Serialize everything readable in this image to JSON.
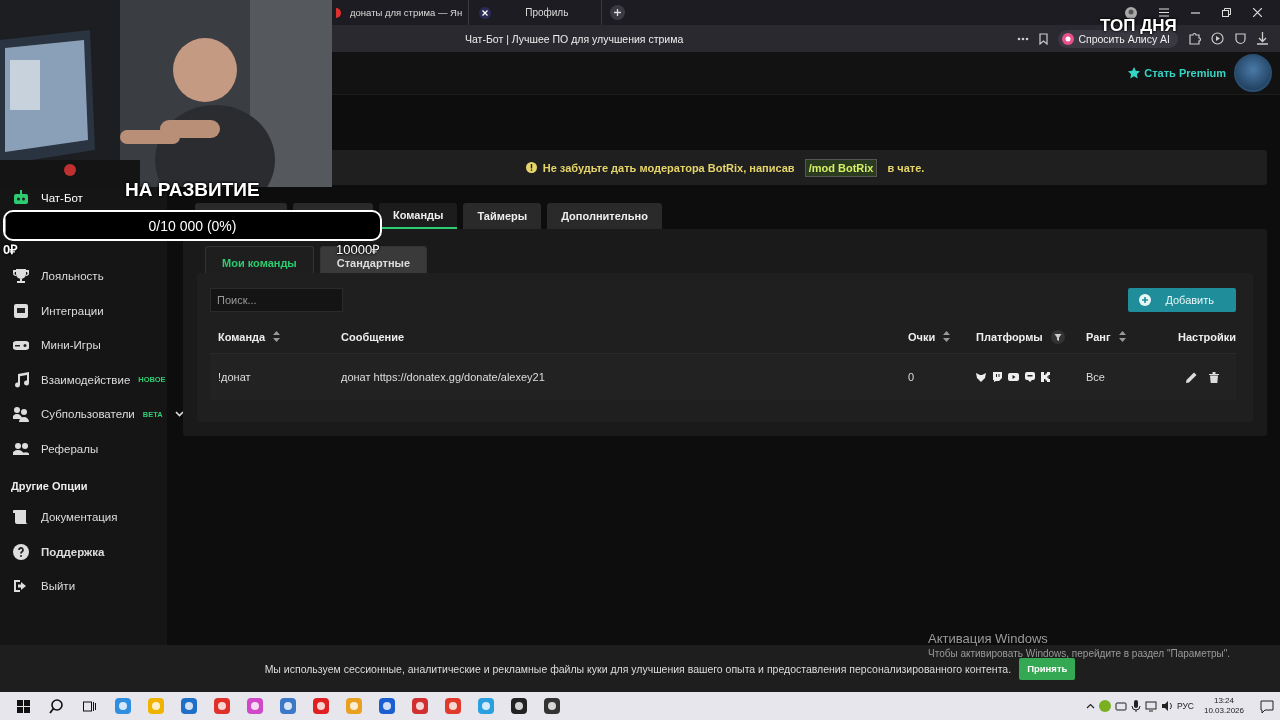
{
  "browser": {
    "tabs": [
      {
        "label": "донаты для стрима — Ян"
      },
      {
        "label": "Профиль"
      }
    ],
    "page_title": "Чат-Бот | Лучшее ПО для улучшения стрима",
    "alice_button": "Спросить Алису AI"
  },
  "header": {
    "premium_link": "Стать Premium"
  },
  "sidebar": {
    "items": [
      {
        "label": "Чат-Бот",
        "selected": true
      },
      {
        "label": "Лояльность",
        "selected": false
      },
      {
        "label": "Интеграции",
        "selected": false
      },
      {
        "label": "Мини-Игры",
        "selected": false
      },
      {
        "label": "Взаимодействие",
        "selected": false,
        "badge": "НОВОЕ"
      },
      {
        "label": "Субпользователи",
        "selected": false,
        "badge": "BETA"
      },
      {
        "label": "Рефералы",
        "selected": false
      }
    ],
    "section_title": "Другие Опции",
    "other_items": [
      {
        "label": "Документация"
      },
      {
        "label": "Поддержка"
      },
      {
        "label": "Выйти"
      }
    ]
  },
  "alert": {
    "text_before": "Не забудьте дать модератора BotRix, написав",
    "code": "/mod BotRix",
    "text_after": "в чате."
  },
  "tabs": [
    {
      "selected": false
    },
    {
      "selected": false
    },
    {
      "label": "Команды",
      "selected": true
    },
    {
      "label": "Таймеры",
      "selected": false
    },
    {
      "label": "Дополнительно",
      "selected": false
    }
  ],
  "subtabs": [
    {
      "label": "Мои команды",
      "selected": true
    },
    {
      "label": "Стандартные",
      "selected": false
    }
  ],
  "search": {
    "placeholder": "Поиск..."
  },
  "add_button": "Добавить",
  "table": {
    "columns": [
      {
        "label": "Команда",
        "sortable": true
      },
      {
        "label": "Сообщение",
        "sortable": false
      },
      {
        "label": "Очки",
        "sortable": true
      },
      {
        "label": "Платформы",
        "filter": true
      },
      {
        "label": "Ранг",
        "sortable": true
      },
      {
        "label": "Настройки",
        "sortable": false
      }
    ],
    "rows": [
      {
        "command": "!донат",
        "message": "донат https://donatex.gg/donate/alexey21",
        "points": "0",
        "rank": "Все"
      }
    ]
  },
  "cookie_bar": {
    "text": "Мы используем сессионные, аналитические и рекламные файлы куки для улучшения вашего опыта и предоставления персонализированного контента.",
    "accept_button": "Принять"
  },
  "windows_activation": {
    "title": "Активация Windows",
    "text": "Чтобы активировать Windows, перейдите в раздел \"Параметры\"."
  },
  "taskbar": {
    "language": "РУС",
    "time": "13:24",
    "date": "10.03.2026"
  },
  "stream_overlay": {
    "goal_title": "НА РАЗВИТИЕ",
    "goal_progress": "0/10 000 (0%)",
    "level": 0,
    "goal_start": "0₽",
    "goal_end": "10000₽",
    "top_label": "ТОП ДНЯ"
  }
}
